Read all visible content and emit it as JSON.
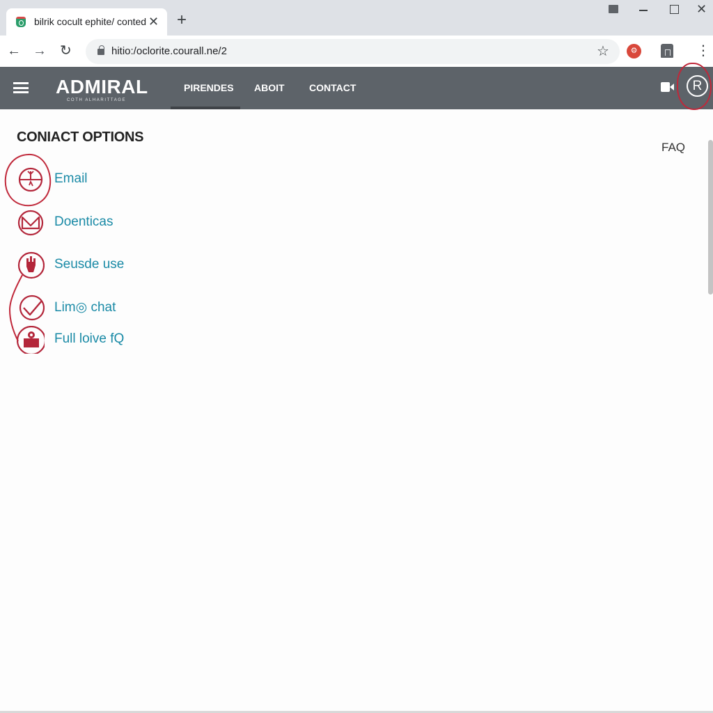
{
  "browser": {
    "tab_title": "bilrik cocult ephite/ conted",
    "tab_close": "✕",
    "new_tab": "+",
    "url": "hitio:/oclorite.courall.ne/2",
    "back": "←",
    "forward": "→",
    "reload": "↻",
    "star": "☆",
    "extension_label": "⚙",
    "menu": "⋮",
    "window_close": "✕"
  },
  "site": {
    "logo": "ADMIRAL",
    "logo_tagline": "COTH ALHARITTAGE",
    "nav": [
      {
        "label": "PIRENDES",
        "active": true
      },
      {
        "label": "ABOIT",
        "active": false
      },
      {
        "label": "CONTACT",
        "active": false
      }
    ],
    "profile_glyph": "R"
  },
  "content": {
    "title": "CONIACT OPTIONS",
    "faq": "FAQ",
    "options": [
      {
        "label": "Email",
        "icon": "compass-icon"
      },
      {
        "label": "Doenticas",
        "icon": "envelope-icon"
      },
      {
        "label": "Seusde use",
        "icon": "hand-icon"
      },
      {
        "label": "Lim◎ chat",
        "icon": "checkmark-icon"
      },
      {
        "label": "Full loive fQ",
        "icon": "phone-icon"
      }
    ]
  },
  "colors": {
    "accent_link": "#1a8aa6",
    "annotation_red": "#c0283a",
    "header_bg": "#5d6369"
  }
}
